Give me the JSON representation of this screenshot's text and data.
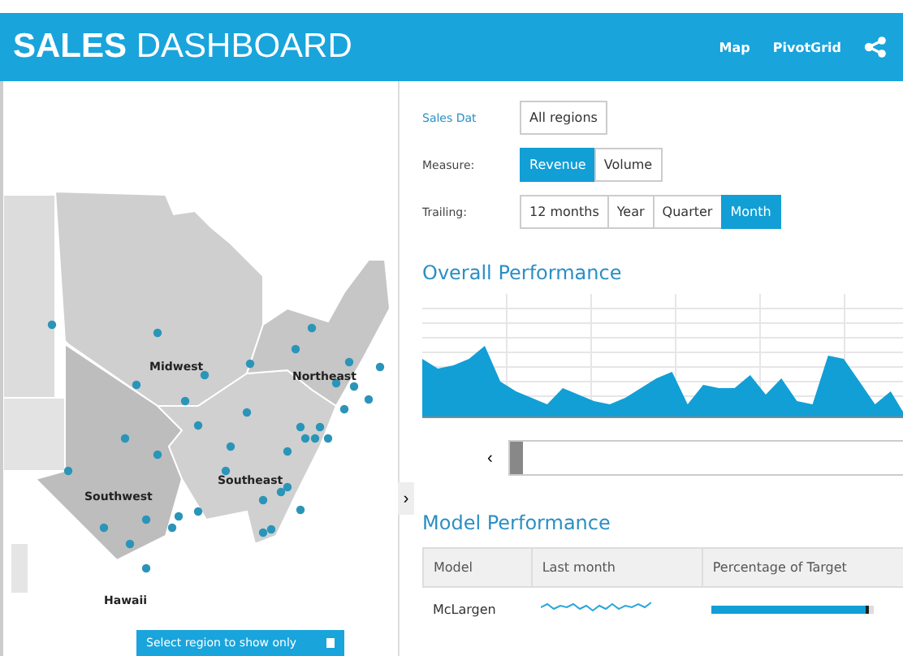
{
  "header": {
    "title": "**SALES** DASHBOARD",
    "links": [
      "Map",
      "PivotGrid"
    ]
  },
  "map": {
    "regions": [
      {
        "label": "Midwest"
      },
      {
        "label": "Northeast"
      },
      {
        "label": "Southwest"
      },
      {
        "label": "Southeast"
      },
      {
        "label": "Hawaii"
      }
    ],
    "region_select": "Select region to show only",
    "collapse": "›"
  },
  "filters": [
    {
      "label": "Sales Dat",
      "options": [
        {
          "label": "All regions",
          "selected": false
        }
      ]
    },
    {
      "label": "Measure:",
      "options": [
        {
          "label": "Revenue",
          "selected": true
        },
        {
          "label": "Volume",
          "selected": false
        }
      ]
    },
    {
      "label": "Trailing:",
      "options": [
        {
          "label": "12 months",
          "selected": false
        },
        {
          "label": "Year",
          "selected": false
        },
        {
          "label": "Quarter",
          "selected": false
        },
        {
          "label": "Month",
          "selected": true
        }
      ]
    }
  ],
  "overall": {
    "title": "Overall Performance",
    "scroll_back": "‹"
  },
  "model": {
    "title": "Model Performance",
    "columns": [
      "Model",
      "Last month",
      "Percentage of Target"
    ],
    "rows": [
      {
        "model": "McLargen",
        "level": 0.97
      }
    ]
  }
}
